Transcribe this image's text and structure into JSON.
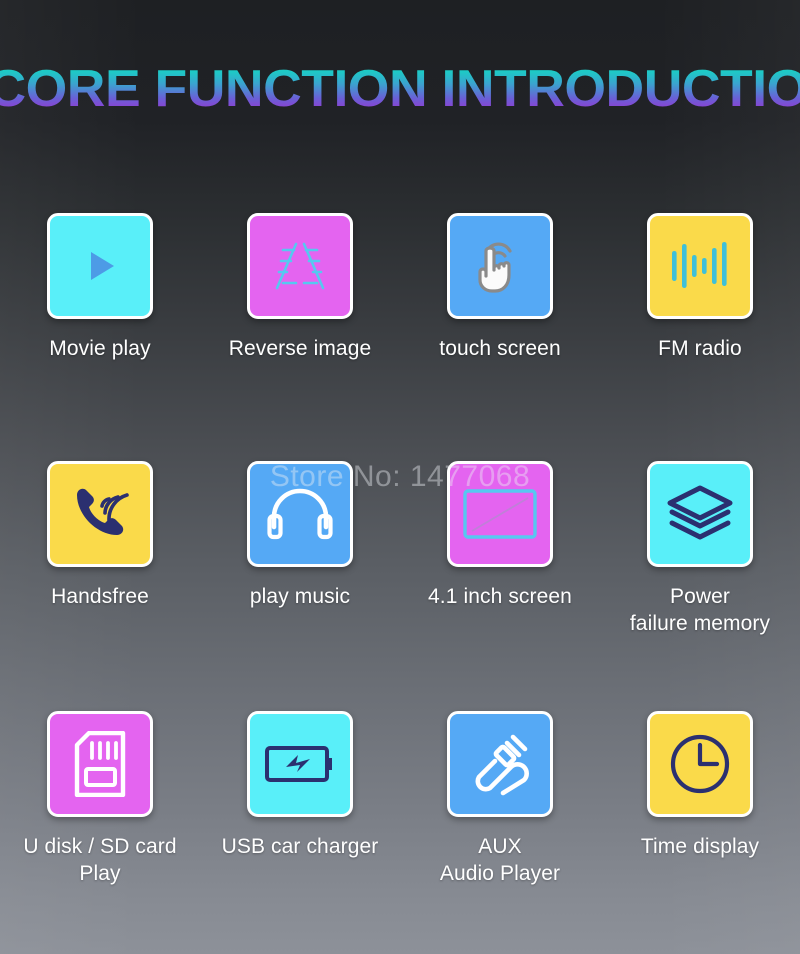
{
  "page": {
    "title": "CORE FUNCTION INTRODUCTION",
    "watermark": "Store No: 1477068",
    "background_top": "#1e2023",
    "background_bottom": "#8d9199",
    "title_gradient_top": "#19cfc4",
    "title_gradient_bottom": "#9a35cf",
    "label_color": "#ffffff"
  },
  "features": [
    {
      "id": "movie-play",
      "label": "Movie play",
      "icon": "play-triangle-icon",
      "tile_color": "#59eff9",
      "icon_color": "#4d9be6"
    },
    {
      "id": "reverse-image",
      "label": "Reverse image",
      "icon": "parking-guideline-icon",
      "tile_color": "#e464f0",
      "icon_color": "#56c8f0"
    },
    {
      "id": "touch-screen",
      "label": "touch screen",
      "icon": "tap-hand-icon",
      "tile_color": "#55a9f5",
      "icon_color": "#ffffff"
    },
    {
      "id": "fm-radio",
      "label": "FM radio",
      "icon": "sound-wave-bars-icon",
      "tile_color": "#fada4a",
      "icon_color": "#3fc0d8"
    },
    {
      "id": "handsfree",
      "label": "Handsfree",
      "icon": "phone-call-icon",
      "tile_color": "#fada4a",
      "icon_color": "#2b3070"
    },
    {
      "id": "play-music",
      "label": "play music",
      "icon": "headphones-icon",
      "tile_color": "#55a9f5",
      "icon_color": "#ffffff"
    },
    {
      "id": "screen-size",
      "label": "4.1 inch screen",
      "icon": "screen-diagonal-icon",
      "tile_color": "#e464f0",
      "icon_color": "#56c8f0"
    },
    {
      "id": "power-failure-memory",
      "label": "Power\nfailure memory",
      "icon": "layers-stack-icon",
      "tile_color": "#59eff9",
      "icon_color": "#2b3070"
    },
    {
      "id": "udisk-sdcard",
      "label": "U disk / SD card\nPlay",
      "icon": "sd-card-icon",
      "tile_color": "#e464f0",
      "icon_color": "#ffffff"
    },
    {
      "id": "usb-car-charger",
      "label": "USB car charger",
      "icon": "battery-bolt-icon",
      "tile_color": "#59eff9",
      "icon_color": "#2b3070"
    },
    {
      "id": "aux-audio-player",
      "label": "AUX\nAudio Player",
      "icon": "audio-jack-cable-icon",
      "tile_color": "#55a9f5",
      "icon_color": "#ffffff"
    },
    {
      "id": "time-display",
      "label": "Time display",
      "icon": "clock-icon",
      "tile_color": "#fada4a",
      "icon_color": "#2b3070"
    }
  ]
}
